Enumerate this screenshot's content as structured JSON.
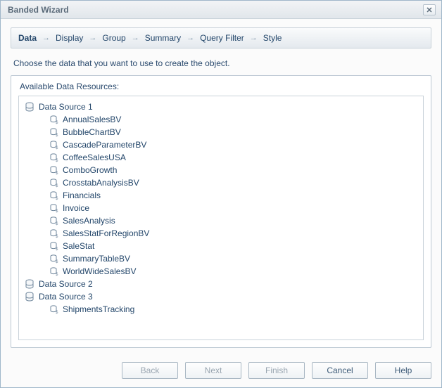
{
  "window": {
    "title": "Banded Wizard"
  },
  "steps": [
    "Data",
    "Display",
    "Group",
    "Summary",
    "Query Filter",
    "Style"
  ],
  "activeStepIndex": 0,
  "instruction": "Choose the data that you want to use to create the object.",
  "sectionLabel": "Available Data Resources:",
  "tree": [
    {
      "label": "Data Source 1",
      "icon": "datasource",
      "children": [
        {
          "label": "AnnualSalesBV",
          "icon": "view"
        },
        {
          "label": "BubbleChartBV",
          "icon": "view"
        },
        {
          "label": "CascadeParameterBV",
          "icon": "view"
        },
        {
          "label": "CoffeeSalesUSA",
          "icon": "view"
        },
        {
          "label": "ComboGrowth",
          "icon": "view"
        },
        {
          "label": "CrosstabAnalysisBV",
          "icon": "view"
        },
        {
          "label": "Financials",
          "icon": "view"
        },
        {
          "label": "Invoice",
          "icon": "view"
        },
        {
          "label": "SalesAnalysis",
          "icon": "view"
        },
        {
          "label": "SalesStatForRegionBV",
          "icon": "view"
        },
        {
          "label": "SaleStat",
          "icon": "view"
        },
        {
          "label": "SummaryTableBV",
          "icon": "view"
        },
        {
          "label": "WorldWideSalesBV",
          "icon": "view"
        }
      ]
    },
    {
      "label": "Data Source 2",
      "icon": "datasource",
      "children": []
    },
    {
      "label": "Data Source 3",
      "icon": "datasource",
      "children": [
        {
          "label": "ShipmentsTracking",
          "icon": "view"
        }
      ]
    }
  ],
  "buttons": {
    "back": "Back",
    "next": "Next",
    "finish": "Finish",
    "cancel": "Cancel",
    "help": "Help"
  },
  "buttonsEnabled": {
    "back": false,
    "next": false,
    "finish": false,
    "cancel": true,
    "help": true
  }
}
